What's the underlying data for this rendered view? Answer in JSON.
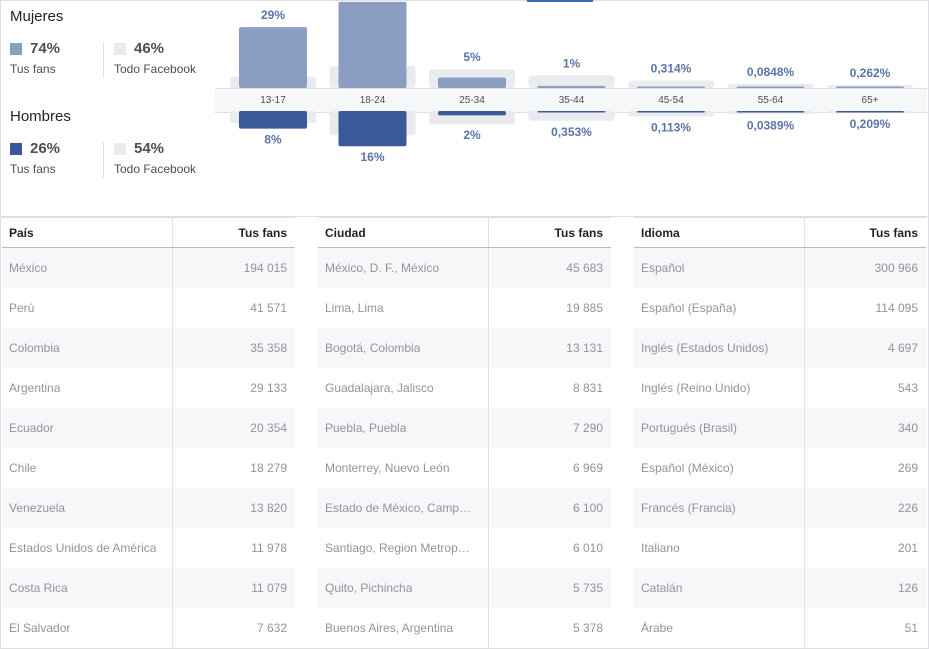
{
  "gender": {
    "women": {
      "title": "Mujeres",
      "fans_pct": "74%",
      "fans_label": "Tus fans",
      "fb_pct": "46%",
      "fb_label": "Todo Facebook"
    },
    "men": {
      "title": "Hombres",
      "fans_pct": "26%",
      "fans_label": "Tus fans",
      "fb_pct": "54%",
      "fb_label": "Todo Facebook"
    }
  },
  "colors": {
    "women": "#8b9dc3",
    "men": "#3b5998",
    "facebook": "#e9ebee",
    "bg_bar": "#e9ebee",
    "label_blue": "#5b74a8"
  },
  "chart_data": {
    "type": "bar",
    "categories": [
      "13-17",
      "18-24",
      "25-34",
      "35-44",
      "45-54",
      "55-64",
      "65+"
    ],
    "series": [
      {
        "name": "Mujeres",
        "values": [
          29,
          41,
          5,
          1,
          0.314,
          0.0848,
          0.262
        ],
        "labels": [
          "29%",
          "",
          "5%",
          "1%",
          "0,314%",
          "0,0848%",
          "0,262%"
        ]
      },
      {
        "name": "Hombres",
        "values": [
          8,
          16,
          2,
          0.353,
          0.113,
          0.0389,
          0.209
        ],
        "labels": [
          "8%",
          "16%",
          "2%",
          "0,353%",
          "0,113%",
          "0,0389%",
          "0,209%"
        ]
      }
    ],
    "facebook_women": [
      5.5,
      10.5,
      9,
      6,
      3.5,
      2,
      1.5
    ],
    "facebook_men": [
      5.5,
      11,
      6,
      4.5,
      2.5,
      1.5,
      1
    ]
  },
  "tables": [
    {
      "col1": "País",
      "col2": "Tus fans",
      "rows": [
        [
          "México",
          "194 015"
        ],
        [
          "Perú",
          "41 571"
        ],
        [
          "Colombia",
          "35 358"
        ],
        [
          "Argentina",
          "29 133"
        ],
        [
          "Ecuador",
          "20 354"
        ],
        [
          "Chile",
          "18 279"
        ],
        [
          "Venezuela",
          "13 820"
        ],
        [
          "Estados Unidos de América",
          "11 978"
        ],
        [
          "Costa Rica",
          "11 079"
        ],
        [
          "El Salvador",
          "7 632"
        ]
      ]
    },
    {
      "col1": "Ciudad",
      "col2": "Tus fans",
      "rows": [
        [
          "México, D. F., México",
          "45 683"
        ],
        [
          "Lima, Lima",
          "19 885"
        ],
        [
          "Bogotá, Colombia",
          "13 131"
        ],
        [
          "Guadalajara, Jalisco",
          "8 831"
        ],
        [
          "Puebla, Puebla",
          "7 290"
        ],
        [
          "Monterrey, Nuevo León",
          "6 969"
        ],
        [
          "Estado de México, Camp…",
          "6 100"
        ],
        [
          "Santiago, Region Metrop…",
          "6 010"
        ],
        [
          "Quito, Pichincha",
          "5 735"
        ],
        [
          "Buenos Aires, Argentina",
          "5 378"
        ]
      ]
    },
    {
      "col1": "Idioma",
      "col2": "Tus fans",
      "rows": [
        [
          "Español",
          "300 966"
        ],
        [
          "Español (España)",
          "114 095"
        ],
        [
          "Inglés (Estados Unidos)",
          "4 697"
        ],
        [
          "Inglés (Reino Unido)",
          "543"
        ],
        [
          "Portugués (Brasil)",
          "340"
        ],
        [
          "Español (México)",
          "269"
        ],
        [
          "Francés (Francia)",
          "226"
        ],
        [
          "Italiano",
          "201"
        ],
        [
          "Catalán",
          "126"
        ],
        [
          "Árabe",
          "51"
        ]
      ]
    }
  ]
}
